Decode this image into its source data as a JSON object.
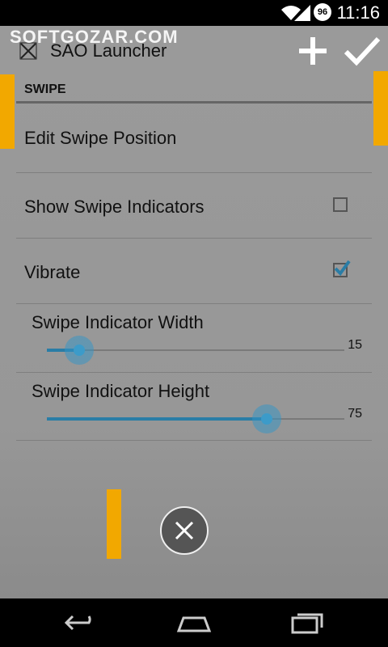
{
  "status_bar": {
    "time": "11:16",
    "battery": "96"
  },
  "watermark": "SOFTGOZAR.COM",
  "action_bar": {
    "title": "SAO Launcher"
  },
  "section": {
    "title": "SWIPE"
  },
  "prefs": {
    "edit_position": "Edit Swipe Position",
    "show_indicators": {
      "label": "Show Swipe Indicators",
      "checked": false
    },
    "vibrate": {
      "label": "Vibrate",
      "checked": true
    }
  },
  "sliders": {
    "width": {
      "label": "Swipe Indicator Width",
      "value": "15"
    },
    "height": {
      "label": "Swipe Indicator Height",
      "value": "75"
    }
  },
  "colors": {
    "accent": "#f2a800",
    "slider": "#3c9bc9"
  }
}
